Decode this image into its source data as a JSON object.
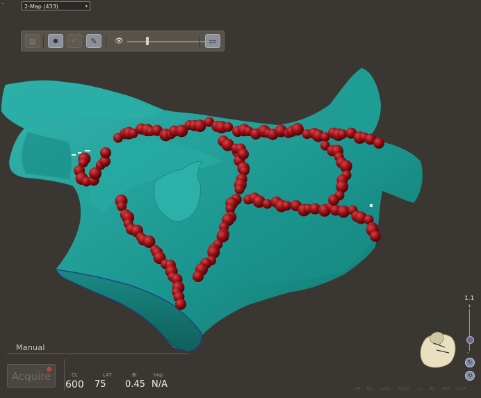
{
  "header": {
    "map_select": "2-Map (433)",
    "corner_mark": "-"
  },
  "toolbar": {
    "items": [
      {
        "name": "grid-tool-button",
        "icon": "grid-icon"
      },
      {
        "name": "chart-tool-button",
        "icon": "chart-icon"
      },
      {
        "name": "undo-tool-button",
        "icon": "undo-icon"
      },
      {
        "name": "pencil-tool-button",
        "icon": "pencil-icon"
      }
    ],
    "transparency_icon": "eye-icon",
    "transparency_level": 0.22,
    "monitor_icon": "monitor-icon"
  },
  "acquisition": {
    "mode_label": "Manual",
    "acquire_label": "Acquire",
    "fields": [
      {
        "label": "CL",
        "value": "600"
      },
      {
        "label": "LAT",
        "value": "75"
      },
      {
        "label": "Bi",
        "value": "0.45"
      },
      {
        "label": "Imp",
        "value": "N/A"
      }
    ]
  },
  "zoom": {
    "value": "1.1",
    "plus": "+",
    "minus": "-"
  },
  "views": [
    "AP",
    "PA",
    "LAO",
    "RAO",
    "LL",
    "RL",
    "INF",
    "SUP"
  ],
  "colors": {
    "background": "#3a3631",
    "anatomy": "#1f9c95",
    "ablation_points": "#9a0f14"
  }
}
